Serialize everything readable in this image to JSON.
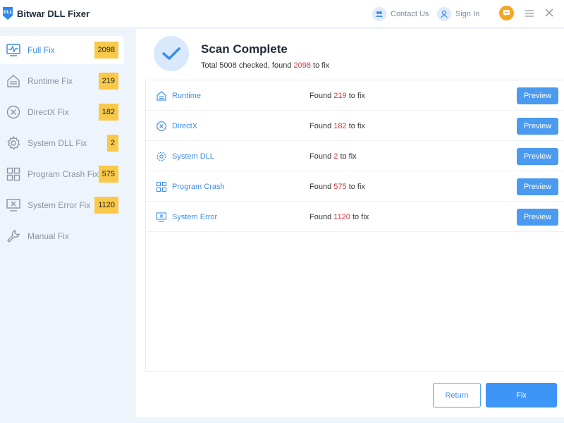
{
  "app": {
    "title": "Bitwar DLL Fixer",
    "logo_text": "DLL"
  },
  "titlebar": {
    "contact_label": "Contact Us",
    "signin_label": "Sign In"
  },
  "sidebar": {
    "items": [
      {
        "label": "Full Fix",
        "count": "2098",
        "icon": "pulse-monitor-icon",
        "active": true
      },
      {
        "label": "Runtime Fix",
        "count": "219",
        "icon": "runtime-icon",
        "active": false
      },
      {
        "label": "DirectX Fix",
        "count": "182",
        "icon": "x-circle-icon",
        "active": false
      },
      {
        "label": "System DLL Fix",
        "count": "2",
        "icon": "gear-icon",
        "active": false
      },
      {
        "label": "Program Crash Fix",
        "count": "575",
        "icon": "grid-icon",
        "active": false
      },
      {
        "label": "System Error Fix",
        "count": "1120",
        "icon": "monitor-error-icon",
        "active": false
      },
      {
        "label": "Manual Fix",
        "count": "",
        "icon": "wrench-icon",
        "active": false
      }
    ]
  },
  "scan": {
    "title": "Scan Complete",
    "summary_prefix": "Total 5008 checked, found",
    "summary_count": "2098",
    "summary_suffix": "to fix"
  },
  "results": {
    "found_prefix": "Found",
    "found_suffix": "to fix",
    "preview_label": "Preview",
    "rows": [
      {
        "name": "Runtime",
        "count": "219",
        "icon": "runtime-icon"
      },
      {
        "name": "DirectX",
        "count": "182",
        "icon": "x-circle-icon"
      },
      {
        "name": "System DLL",
        "count": "2",
        "icon": "gear-icon"
      },
      {
        "name": "Program Crash",
        "count": "575",
        "icon": "grid-icon"
      },
      {
        "name": "System Error",
        "count": "1120",
        "icon": "monitor-error-icon"
      }
    ]
  },
  "footer": {
    "return_label": "Return",
    "fix_label": "Fix"
  },
  "colors": {
    "accent": "#3d8ee8",
    "badge": "#f9c94a",
    "count_red": "#d9363e",
    "sidebar_bg": "#eef4fb"
  }
}
